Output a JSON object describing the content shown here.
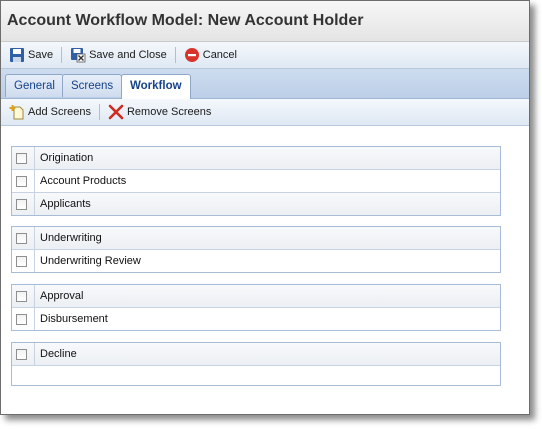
{
  "window": {
    "title": "Account Workflow Model: New Account Holder"
  },
  "toolbar": {
    "save_label": "Save",
    "save_close_label": "Save and Close",
    "cancel_label": "Cancel"
  },
  "tabs": [
    {
      "label": "General"
    },
    {
      "label": "Screens"
    },
    {
      "label": "Workflow"
    }
  ],
  "subtoolbar": {
    "add_label": "Add Screens",
    "remove_label": "Remove Screens"
  },
  "groups": [
    {
      "items": [
        "Origination",
        "Account Products",
        "Applicants"
      ]
    },
    {
      "items": [
        "Underwriting",
        "Underwriting Review"
      ]
    },
    {
      "items": [
        "Approval",
        "Disbursement"
      ]
    },
    {
      "items": [
        "Decline"
      ]
    }
  ],
  "colors": {
    "tab_text": "#15428b",
    "cancel_red": "#d9342b"
  }
}
